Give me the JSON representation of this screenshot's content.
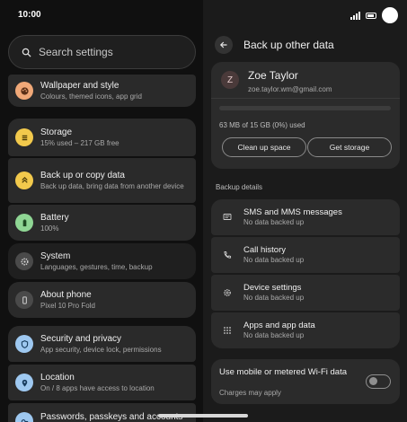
{
  "status_bar": {
    "time": "10:00"
  },
  "search": {
    "placeholder": "Search settings"
  },
  "settings_list": [
    {
      "title": "Wallpaper and style",
      "subtitle": "Colours, themed icons, app grid",
      "icon": "palette-icon",
      "color": "#f0a878"
    },
    {
      "title": "Storage",
      "subtitle": "15% used – 217 GB free",
      "icon": "storage-icon",
      "color": "#f2c94c"
    },
    {
      "title": "Back up or copy data",
      "subtitle": "Back up data, bring data from another device",
      "icon": "backup-icon",
      "color": "#f2c94c"
    },
    {
      "title": "Battery",
      "subtitle": "100%",
      "icon": "battery-icon",
      "color": "#8fd694"
    },
    {
      "title": "System",
      "subtitle": "Languages, gestures, time, backup",
      "icon": "gear-icon",
      "color": "#bdbdbd"
    },
    {
      "title": "About phone",
      "subtitle": "Pixel 10 Pro Fold",
      "icon": "phone-icon",
      "color": "#bdbdbd"
    },
    {
      "title": "Security and privacy",
      "subtitle": "App security, device lock, permissions",
      "icon": "shield-icon",
      "color": "#9ec8f0"
    },
    {
      "title": "Location",
      "subtitle": "On / 8 apps have access to location",
      "icon": "location-icon",
      "color": "#9ec8f0"
    },
    {
      "title": "Passwords, passkeys and accounts",
      "subtitle": "",
      "icon": "key-icon",
      "color": "#9ec8f0"
    }
  ],
  "backup": {
    "title": "Back up other data",
    "account": {
      "initial": "Z",
      "name": "Zoe Taylor",
      "email": "zoe.taylor.wm@gmail.com"
    },
    "storage_text": "63 MB of 15 GB (0%) used",
    "storage_fraction": 0.0,
    "clean_up_label": "Clean up space",
    "get_storage_label": "Get storage",
    "section_title": "Backup details",
    "rows": [
      {
        "title": "SMS and MMS messages",
        "subtitle": "No data backed up",
        "icon": "message-icon"
      },
      {
        "title": "Call history",
        "subtitle": "No data backed up",
        "icon": "call-icon"
      },
      {
        "title": "Device settings",
        "subtitle": "No data backed up",
        "icon": "gear-icon"
      },
      {
        "title": "Apps and app data",
        "subtitle": "No data backed up",
        "icon": "apps-grid-icon"
      }
    ],
    "metered": {
      "title": "Use mobile or metered Wi-Fi data",
      "subtitle": "Charges may apply",
      "enabled": false
    }
  }
}
